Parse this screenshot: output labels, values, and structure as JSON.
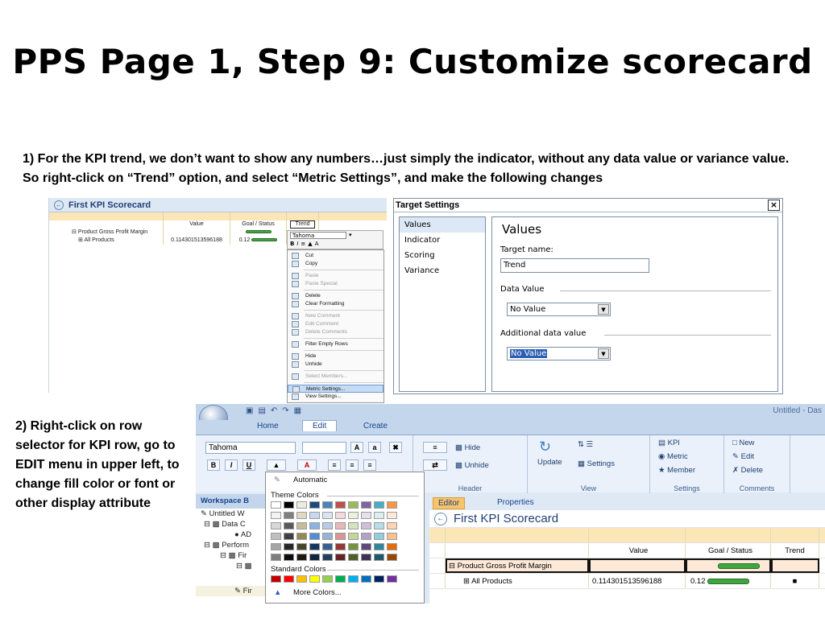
{
  "title": "PPS Page 1, Step 9: Customize scorecard",
  "step1_text": "1) For the KPI trend, we don’t want to show any numbers…just simply the indicator, without any data value or variance value. So right-click on “Trend” option, and select “Metric Settings”, and make the following changes",
  "step2_text": "2) Right-click on row selector for KPI row, go to EDIT menu in upper left, to change fill color or font or other display attribute",
  "scorecard_small": {
    "title": "First KPI Scorecard",
    "columns": [
      "Value",
      "Goal / Status",
      "Trend"
    ],
    "rows": [
      {
        "name": "Product Gross Profit Margin",
        "value": "",
        "goal": ""
      },
      {
        "name": "All Products",
        "value": "0.114301513596188",
        "goal": "0.12"
      }
    ],
    "font_value": "Tahoma",
    "context_menu": [
      {
        "label": "Cut",
        "dim": false
      },
      {
        "label": "Copy",
        "dim": false
      },
      {
        "label": "Paste",
        "dim": true
      },
      {
        "label": "Paste Special",
        "dim": true
      },
      {
        "label": "Delete",
        "dim": false
      },
      {
        "label": "Clear Formatting",
        "dim": false
      },
      {
        "label": "New Comment",
        "dim": true
      },
      {
        "label": "Edit Comment",
        "dim": true
      },
      {
        "label": "Delete Comments",
        "dim": true
      },
      {
        "label": "Filter Empty Rows",
        "dim": false
      },
      {
        "label": "Hide",
        "dim": false
      },
      {
        "label": "Unhide",
        "dim": false
      },
      {
        "label": "Select Members...",
        "dim": true
      },
      {
        "label": "Metric Settings...",
        "dim": false,
        "selected": true
      },
      {
        "label": "View Settings...",
        "dim": false
      }
    ]
  },
  "dialog": {
    "title": "Target Settings",
    "close": "×",
    "nav": [
      "Values",
      "Indicator",
      "Scoring",
      "Variance"
    ],
    "heading": "Values",
    "target_name_label": "Target name:",
    "target_name_value": "Trend",
    "data_value_label": "Data Value",
    "data_value_selected": "No Value",
    "additional_label": "Additional data value",
    "additional_selected": "No Value"
  },
  "ribbon": {
    "window_title": "Untitled - Das",
    "tabs": [
      "Home",
      "Edit",
      "Create"
    ],
    "font_value": "Tahoma",
    "buttons": {
      "hide": "Hide",
      "unhide": "Unhide",
      "update": "Update",
      "settings": "Settings",
      "kpi": "KPI",
      "metric": "Metric",
      "member": "Member",
      "new": "New",
      "edit": "Edit",
      "delete": "Delete"
    },
    "groups": [
      "Header",
      "View",
      "Settings",
      "Comments"
    ],
    "panel_tabs": [
      "Editor",
      "Properties"
    ],
    "workspace": {
      "head": "Workspace B",
      "items": [
        "Untitled W",
        "Data C",
        "AD",
        "Perform",
        "Fir",
        "",
        "Fir"
      ]
    },
    "scorecard": {
      "title": "First KPI Scorecard",
      "columns": [
        "Value",
        "Goal / Status",
        "Trend"
      ],
      "rows": [
        {
          "name": "Product Gross Profit Margin",
          "value": "",
          "goal": ""
        },
        {
          "name": "All Products",
          "value": "0.114301513596188",
          "goal": "0.12"
        }
      ]
    },
    "palette": {
      "automatic": "Automatic",
      "theme_label": "Theme Colors",
      "standard_label": "Standard Colors",
      "more": "More Colors...",
      "theme_colors": [
        [
          "#ffffff",
          "#000000",
          "#eeece1",
          "#1f497d",
          "#4f81bd",
          "#c0504d",
          "#9bbb59",
          "#8064a2",
          "#4bacc6",
          "#f79646"
        ],
        [
          "#f2f2f2",
          "#7f7f7f",
          "#ddd9c3",
          "#c6d9f0",
          "#dbe5f1",
          "#f2dcdb",
          "#ebf1dd",
          "#e5e0ec",
          "#dbeef3",
          "#fdeada"
        ],
        [
          "#d8d8d8",
          "#595959",
          "#c4bd97",
          "#8db3e2",
          "#b8cce4",
          "#e5b9b7",
          "#d7e3bc",
          "#ccc1d9",
          "#b7dde8",
          "#fbd5b5"
        ],
        [
          "#bfbfbf",
          "#3f3f3f",
          "#938953",
          "#548dd4",
          "#95b3d7",
          "#d99694",
          "#c3d69b",
          "#b2a2c7",
          "#92cddc",
          "#fac08f"
        ],
        [
          "#a5a5a5",
          "#262626",
          "#494429",
          "#17365d",
          "#366092",
          "#953734",
          "#76923c",
          "#5f497a",
          "#31859b",
          "#e36c09"
        ],
        [
          "#7f7f7f",
          "#0c0c0c",
          "#1d1b10",
          "#0f243e",
          "#244061",
          "#632423",
          "#4f6128",
          "#3f3151",
          "#205867",
          "#974806"
        ]
      ],
      "standard_colors": [
        "#c00000",
        "#ff0000",
        "#ffc000",
        "#ffff00",
        "#92d050",
        "#00b050",
        "#00b0f0",
        "#0070c0",
        "#002060",
        "#7030a0"
      ]
    }
  }
}
